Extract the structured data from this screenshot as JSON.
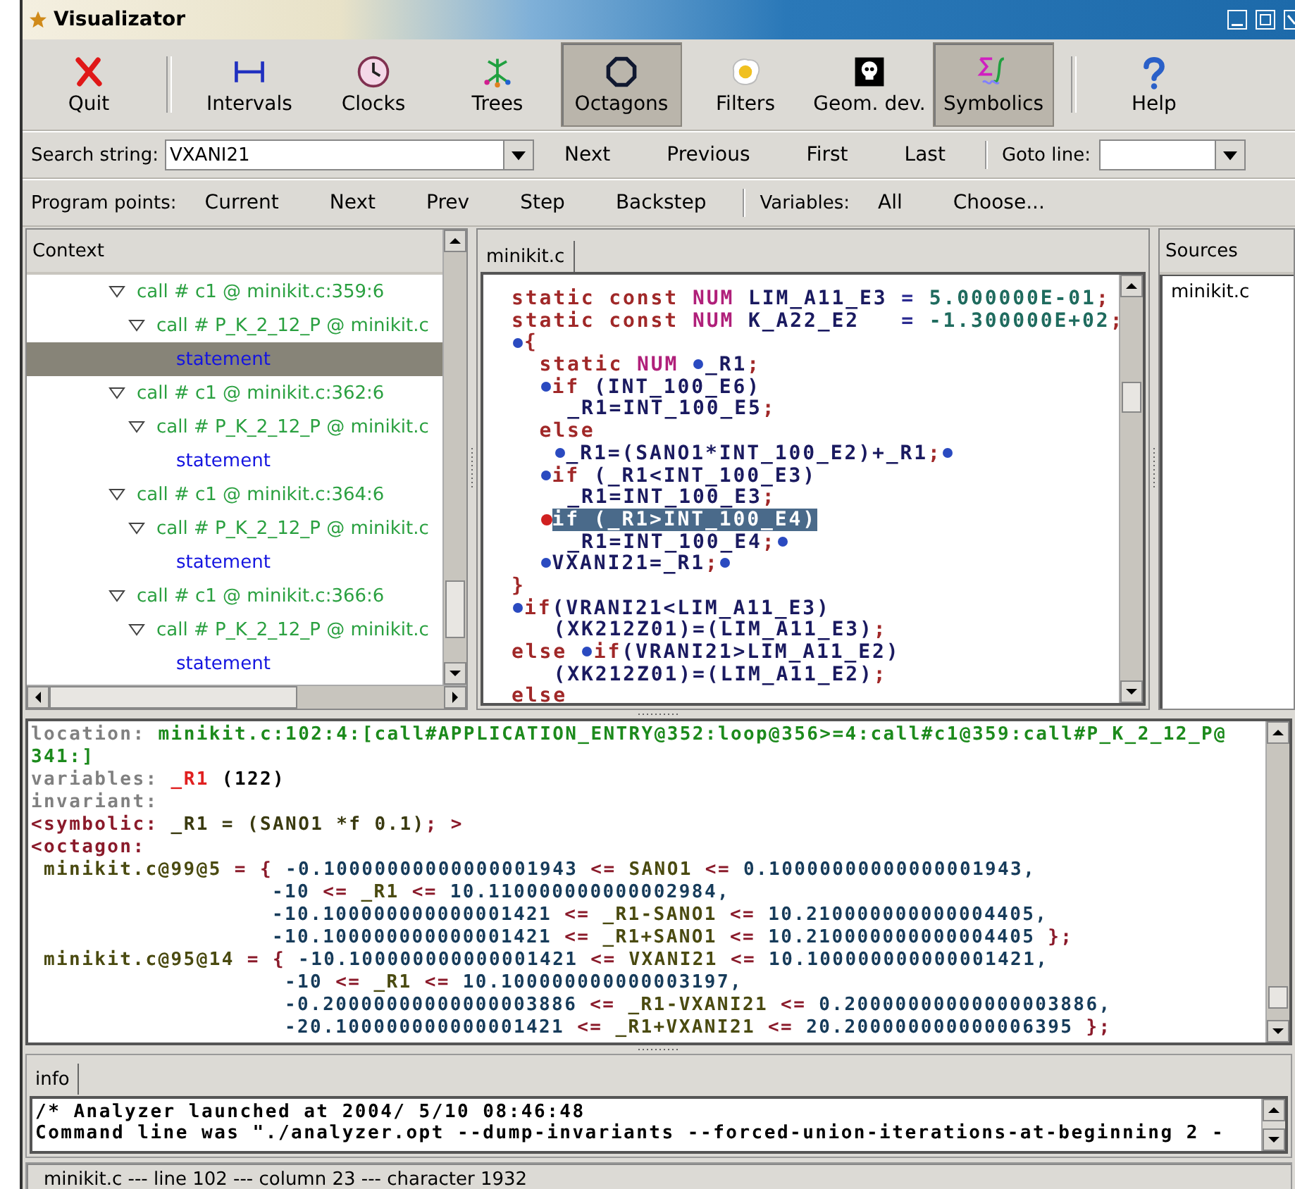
{
  "window": {
    "title": "Visualizator"
  },
  "toolbar": [
    {
      "label": "Quit",
      "on": false
    },
    {
      "label": "Intervals",
      "on": false
    },
    {
      "label": "Clocks",
      "on": false
    },
    {
      "label": "Trees",
      "on": false
    },
    {
      "label": "Octagons",
      "on": true
    },
    {
      "label": "Filters",
      "on": false
    },
    {
      "label": "Geom. dev.",
      "on": false
    },
    {
      "label": "Symbolics",
      "on": true
    },
    {
      "label": "Help",
      "on": false
    }
  ],
  "search": {
    "label": "Search string:",
    "value": "VXANI21",
    "buttons": [
      "Next",
      "Previous",
      "First",
      "Last"
    ],
    "goto_label": "Goto line:"
  },
  "program_points": {
    "label": "Program points:",
    "buttons": [
      "Current",
      "Next",
      "Prev",
      "Step",
      "Backstep"
    ],
    "variables_label": "Variables:",
    "variable_buttons": [
      "All",
      "Choose..."
    ]
  },
  "context": {
    "title": "Context",
    "items": [
      {
        "kind": "call",
        "label": "call # c1 @ minikit.c:359:6",
        "expanded": true,
        "selected": false,
        "children": [
          {
            "kind": "call",
            "label": "call # P_K_2_12_P @ minikit.c",
            "expanded": true,
            "selected": false,
            "children": [
              {
                "kind": "statement",
                "label": "statement",
                "selected": true
              }
            ]
          }
        ]
      },
      {
        "kind": "call",
        "label": "call # c1 @ minikit.c:362:6",
        "expanded": true,
        "selected": false,
        "children": [
          {
            "kind": "call",
            "label": "call # P_K_2_12_P @ minikit.c",
            "expanded": true,
            "selected": false,
            "children": [
              {
                "kind": "statement",
                "label": "statement",
                "selected": false
              }
            ]
          }
        ]
      },
      {
        "kind": "call",
        "label": "call # c1 @ minikit.c:364:6",
        "expanded": true,
        "selected": false,
        "children": [
          {
            "kind": "call",
            "label": "call # P_K_2_12_P @ minikit.c",
            "expanded": true,
            "selected": false,
            "children": [
              {
                "kind": "statement",
                "label": "statement",
                "selected": false
              }
            ]
          }
        ]
      },
      {
        "kind": "call",
        "label": "call # c1 @ minikit.c:366:6",
        "expanded": true,
        "selected": false,
        "children": [
          {
            "kind": "call",
            "label": "call # P_K_2_12_P @ minikit.c",
            "expanded": true,
            "selected": false,
            "children": [
              {
                "kind": "statement",
                "label": "statement",
                "selected": false
              }
            ]
          }
        ]
      }
    ]
  },
  "editor": {
    "tab": "minikit.c",
    "lines": [
      {
        "kind": "outer",
        "segments": [
          {
            "text": "static const ",
            "kind": "kw"
          },
          {
            "text": "NUM ",
            "kind": "type"
          },
          {
            "text": "LIM_A11_E3 ",
            "kind": "id"
          },
          {
            "text": "= ",
            "kind": "op"
          },
          {
            "text": "5.000000E-01",
            "kind": "num"
          },
          {
            "text": ";",
            "kind": "kw"
          }
        ]
      },
      {
        "kind": "outer",
        "segments": [
          {
            "text": "static const ",
            "kind": "kw"
          },
          {
            "text": "NUM ",
            "kind": "type"
          },
          {
            "text": "K_A22_E2   ",
            "kind": "id"
          },
          {
            "text": "= ",
            "kind": "op"
          },
          {
            "text": "-1.300000E+02",
            "kind": "num"
          },
          {
            "text": ";",
            "kind": "kw"
          }
        ]
      },
      {
        "kind": "outer",
        "segments": [
          {
            "kind": "dot"
          },
          {
            "text": "{",
            "kind": "kw"
          }
        ]
      },
      {
        "kind": "block",
        "segments": [
          {
            "text": "static ",
            "kind": "kw"
          },
          {
            "text": "NUM ",
            "kind": "type"
          },
          {
            "kind": "dot"
          },
          {
            "text": "_R1",
            "kind": "id"
          },
          {
            "text": ";",
            "kind": "kw"
          }
        ]
      },
      {
        "kind": "block",
        "segments": [
          {
            "kind": "dot"
          },
          {
            "text": "if ",
            "kind": "kw"
          },
          {
            "text": "(INT_100_E6)",
            "kind": "id"
          }
        ]
      },
      {
        "kind": "body",
        "segments": [
          {
            "text": "_R1=INT_100_E5",
            "kind": "id"
          },
          {
            "text": ";",
            "kind": "kw"
          }
        ]
      },
      {
        "kind": "block",
        "segments": [
          {
            "text": "else",
            "kind": "kw"
          }
        ]
      },
      {
        "kind": "cont",
        "segments": [
          {
            "kind": "dot"
          },
          {
            "text": "_R1=(SANO1*INT_100_E2)+_R1",
            "kind": "id"
          },
          {
            "text": ";",
            "kind": "kw"
          },
          {
            "kind": "dot"
          }
        ]
      },
      {
        "kind": "block",
        "segments": [
          {
            "kind": "dot"
          },
          {
            "text": "if ",
            "kind": "kw"
          },
          {
            "text": "(_R1<INT_100_E3)",
            "kind": "id"
          }
        ]
      },
      {
        "kind": "body",
        "segments": [
          {
            "text": "_R1=INT_100_E3",
            "kind": "id"
          },
          {
            "text": ";",
            "kind": "kw"
          }
        ]
      },
      {
        "kind": "block",
        "segments": [
          {
            "kind": "current"
          },
          {
            "text": "if (_R1>INT_100_E4)",
            "kind": "selection"
          }
        ]
      },
      {
        "kind": "body",
        "segments": [
          {
            "text": "_R1=INT_100_E4",
            "kind": "id"
          },
          {
            "text": ";",
            "kind": "kw"
          },
          {
            "kind": "dot"
          }
        ]
      },
      {
        "kind": "block",
        "segments": [
          {
            "kind": "dot"
          },
          {
            "text": "VXANI21=_R1",
            "kind": "id"
          },
          {
            "text": ";",
            "kind": "kw"
          },
          {
            "kind": "dot"
          }
        ]
      },
      {
        "kind": "outer",
        "segments": [
          {
            "text": "}",
            "kind": "kw"
          }
        ]
      },
      {
        "kind": "outer",
        "segments": [
          {
            "kind": "dot"
          },
          {
            "text": "if",
            "kind": "kw"
          },
          {
            "text": "(VRANI21<LIM_A11_E3)",
            "kind": "id"
          }
        ]
      },
      {
        "kind": "cont",
        "segments": [
          {
            "text": "(XK212Z01)=(LIM_A11_E3)",
            "kind": "id"
          },
          {
            "text": ";",
            "kind": "kw"
          }
        ]
      },
      {
        "kind": "outer",
        "segments": [
          {
            "text": "else ",
            "kind": "kw"
          },
          {
            "kind": "dot"
          },
          {
            "text": "if",
            "kind": "kw"
          },
          {
            "text": "(VRANI21>LIM_A11_E2)",
            "kind": "id"
          }
        ]
      },
      {
        "kind": "cont",
        "segments": [
          {
            "text": "(XK212Z01)=(LIM_A11_E2)",
            "kind": "id"
          },
          {
            "text": ";",
            "kind": "kw"
          }
        ]
      },
      {
        "kind": "outer",
        "segments": [
          {
            "text": "else",
            "kind": "kw"
          }
        ]
      }
    ]
  },
  "sources": {
    "title": "Sources",
    "items": [
      "minikit.c"
    ]
  },
  "output": [
    {
      "kind": "line",
      "segments": [
        {
          "text": "location: ",
          "kind": "label"
        },
        {
          "text": "minikit.c:102:4:[call#APPLICATION_ENTRY@352:loop@356>=4:call#c1@359:call#P_K_2_12_P@",
          "kind": "path"
        }
      ]
    },
    {
      "kind": "line",
      "segments": [
        {
          "text": "341:]",
          "kind": "path"
        }
      ]
    },
    {
      "kind": "line",
      "segments": [
        {
          "text": "variables: ",
          "kind": "label"
        },
        {
          "text": "_R1",
          "kind": "var"
        },
        {
          "text": " (122)",
          "kind": "plain"
        }
      ]
    },
    {
      "kind": "line",
      "segments": [
        {
          "text": "invariant:",
          "kind": "label"
        }
      ]
    },
    {
      "kind": "line",
      "segments": [
        {
          "text": "<symbolic: ",
          "kind": "tag"
        },
        {
          "text": "_R1 = (SANO1 *f 0.1)",
          "kind": "expr"
        },
        {
          "text": "; >",
          "kind": "tag"
        }
      ]
    },
    {
      "kind": "line",
      "segments": [
        {
          "text": "<octagon:",
          "kind": "tag"
        }
      ]
    },
    {
      "kind": "entry",
      "segments": [
        {
          "text": "minikit.c@99@5",
          "kind": "name"
        },
        {
          "text": " = { ",
          "kind": "op"
        },
        {
          "text": "-0.10000000000000001943",
          "kind": "num"
        },
        {
          "text": " <= ",
          "kind": "op"
        },
        {
          "text": "SANO1",
          "kind": "name"
        },
        {
          "text": " <= ",
          "kind": "op"
        },
        {
          "text": "0.10000000000000001943,",
          "kind": "num"
        }
      ]
    },
    {
      "kind": "bound",
      "segments": [
        {
          "text": "-10",
          "kind": "num"
        },
        {
          "text": " <= ",
          "kind": "op"
        },
        {
          "text": "_R1",
          "kind": "name"
        },
        {
          "text": " <= ",
          "kind": "op"
        },
        {
          "text": "10.110000000000002984,",
          "kind": "num"
        }
      ]
    },
    {
      "kind": "bound",
      "segments": [
        {
          "text": "-10.100000000000001421",
          "kind": "num"
        },
        {
          "text": " <= ",
          "kind": "op"
        },
        {
          "text": "_R1-SANO1",
          "kind": "name"
        },
        {
          "text": " <= ",
          "kind": "op"
        },
        {
          "text": "10.210000000000004405,",
          "kind": "num"
        }
      ]
    },
    {
      "kind": "bound",
      "segments": [
        {
          "text": "-10.100000000000001421",
          "kind": "num"
        },
        {
          "text": " <= ",
          "kind": "op"
        },
        {
          "text": "_R1+SANO1",
          "kind": "name"
        },
        {
          "text": " <= ",
          "kind": "op"
        },
        {
          "text": "10.210000000000004405",
          "kind": "num"
        },
        {
          "text": " };",
          "kind": "op"
        }
      ]
    },
    {
      "kind": "entry",
      "segments": [
        {
          "text": "minikit.c@95@14",
          "kind": "name"
        },
        {
          "text": " = { ",
          "kind": "op"
        },
        {
          "text": "-10.100000000000001421",
          "kind": "num"
        },
        {
          "text": " <= ",
          "kind": "op"
        },
        {
          "text": "VXANI21",
          "kind": "name"
        },
        {
          "text": " <= ",
          "kind": "op"
        },
        {
          "text": "10.100000000000001421,",
          "kind": "num"
        }
      ]
    },
    {
      "kind": "bound2",
      "segments": [
        {
          "text": "-10",
          "kind": "num"
        },
        {
          "text": " <= ",
          "kind": "op"
        },
        {
          "text": "_R1",
          "kind": "name"
        },
        {
          "text": " <= ",
          "kind": "op"
        },
        {
          "text": "10.100000000000003197,",
          "kind": "num"
        }
      ]
    },
    {
      "kind": "bound2",
      "segments": [
        {
          "text": "-0.20000000000000003886",
          "kind": "num"
        },
        {
          "text": " <= ",
          "kind": "op"
        },
        {
          "text": "_R1-VXANI21",
          "kind": "name"
        },
        {
          "text": " <= ",
          "kind": "op"
        },
        {
          "text": "0.20000000000000003886,",
          "kind": "num"
        }
      ]
    },
    {
      "kind": "bound2",
      "segments": [
        {
          "text": "-20.100000000000001421",
          "kind": "num"
        },
        {
          "text": " <= ",
          "kind": "op"
        },
        {
          "text": "_R1+VXANI21",
          "kind": "name"
        },
        {
          "text": " <= ",
          "kind": "op"
        },
        {
          "text": "20.200000000000006395",
          "kind": "num"
        },
        {
          "text": " };",
          "kind": "op"
        }
      ]
    }
  ],
  "info": {
    "tab": "info",
    "lines": [
      "/* Analyzer launched at 2004/ 5/10 08:46:48",
      "Command line was \"./analyzer.opt --dump-invariants --forced-union-iterations-at-beginning 2 -"
    ]
  },
  "status_bar": "minikit.c --- line 102 --- column 23 --- character 1932"
}
